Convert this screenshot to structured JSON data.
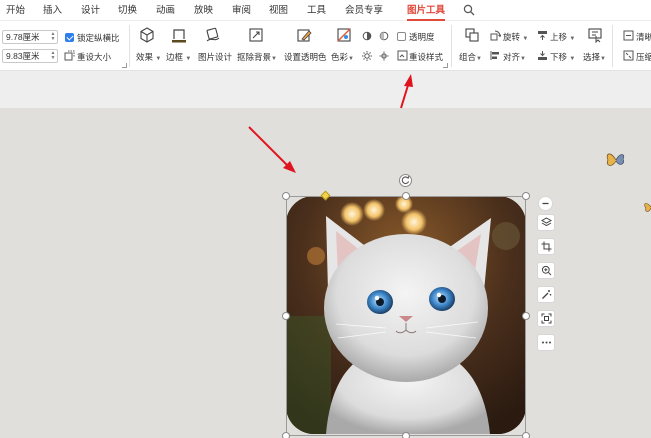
{
  "menu": {
    "items": [
      "开始",
      "插入",
      "设计",
      "切换",
      "动画",
      "放映",
      "审阅",
      "视图",
      "工具",
      "会员专享",
      "图片工具"
    ],
    "active": "图片工具"
  },
  "ribbon": {
    "width_value": "9.78厘米",
    "height_value": "9.83厘米",
    "lock_ratio_label": "锁定纵横比",
    "reset_size_label": "重设大小",
    "effects_label": "效果",
    "border_label": "边框",
    "picture_design_label": "图片设计",
    "cutout_bg_label": "抠除背景",
    "set_transparent_label": "设置透明色",
    "color_label": "色彩",
    "transparency_label": "透明度",
    "reset_style_label": "重设样式",
    "combine_label": "组合",
    "rotate_label": "旋转",
    "align_label": "对齐",
    "move_up_label": "上移",
    "move_down_label": "下移",
    "select_label": "选择",
    "clear_label": "清晰",
    "compress_label": "压缩"
  },
  "colors": {
    "accent": "#e0483a",
    "checkbox": "#2f7ef0",
    "arrow": "#e0141e",
    "slide_bg": "#e0dfdb"
  },
  "side_tools": [
    "minus-icon",
    "layers-icon",
    "crop-icon",
    "zoom-icon",
    "magic-wand-icon",
    "scan-icon",
    "more-icon"
  ]
}
